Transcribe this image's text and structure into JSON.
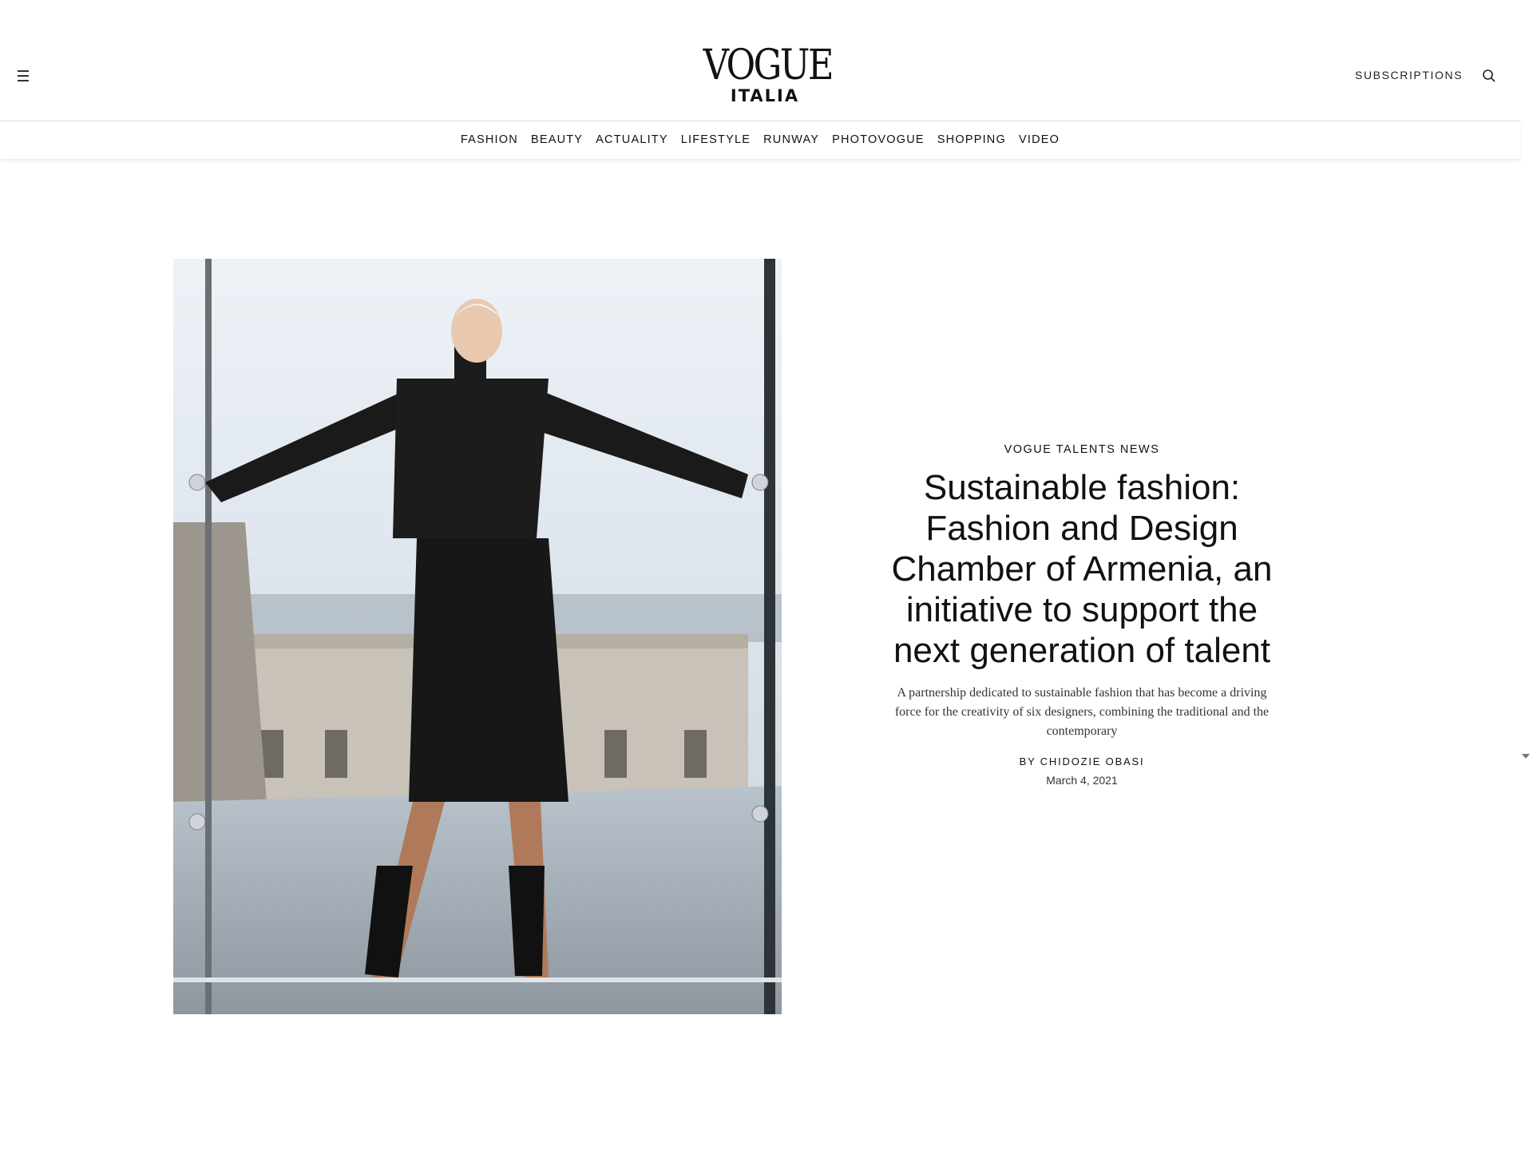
{
  "header": {
    "logo_main": "VOGUE",
    "logo_sub": "ITALIA",
    "subscriptions_label": "SUBSCRIPTIONS"
  },
  "nav": {
    "items": [
      "FASHION",
      "BEAUTY",
      "ACTUALITY",
      "LIFESTYLE",
      "RUNWAY",
      "PHOTOVOGUE",
      "SHOPPING",
      "VIDEO"
    ]
  },
  "article": {
    "rubric": "VOGUE TALENTS NEWS",
    "headline": "Sustainable fashion: Fashion and Design Chamber of Armenia, an initiative to support the next generation of talent",
    "dek": "A partnership dedicated to sustainable fashion that has become a driving force for the creativity of six designers, combining the traditional and the contemporary",
    "byline": "BY CHIDOZIE OBASI",
    "date": "March 4, 2021"
  },
  "icons": {
    "menu": "hamburger-icon",
    "search": "search-icon",
    "scroll": "scroll-down-arrow-icon"
  }
}
